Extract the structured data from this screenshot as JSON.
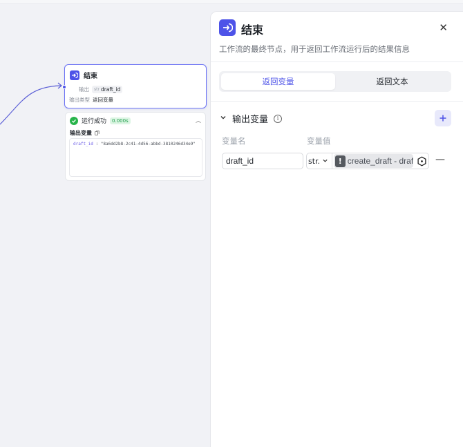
{
  "canvas": {
    "node": {
      "title": "结束",
      "output_label": "输出",
      "output_type_tag": "str",
      "output_var": "draft_id",
      "output_kind_label": "输出类型",
      "output_kind_value": "返回变量"
    },
    "result": {
      "status": "运行成功",
      "duration": "0.000s",
      "label": "输出变量",
      "key": "draft_id",
      "sep": " : ",
      "value": "\"8a6dd2b8-2c41-4d56-abbd-3810246d34e9\""
    }
  },
  "panel": {
    "title": "结束",
    "description": "工作流的最终节点，用于返回工作流运行后的结果信息",
    "tabs": [
      {
        "label": "返回变量",
        "active": true
      },
      {
        "label": "返回文本",
        "active": false
      }
    ],
    "section_title": "输出变量",
    "columns": {
      "name": "变量名",
      "value": "变量值"
    },
    "rows": [
      {
        "name": "draft_id",
        "type": "str.",
        "ref": "create_draft - draft_id"
      }
    ]
  },
  "colors": {
    "accent": "#4d53e8",
    "success": "#28b44b",
    "edge": "#5b5fd6"
  },
  "icons": {
    "node": "end-node-icon",
    "close": "close-icon",
    "info": "info-icon",
    "add": "plus-icon",
    "warning": "warning-icon",
    "variable_picker": "variable-picker-icon"
  }
}
